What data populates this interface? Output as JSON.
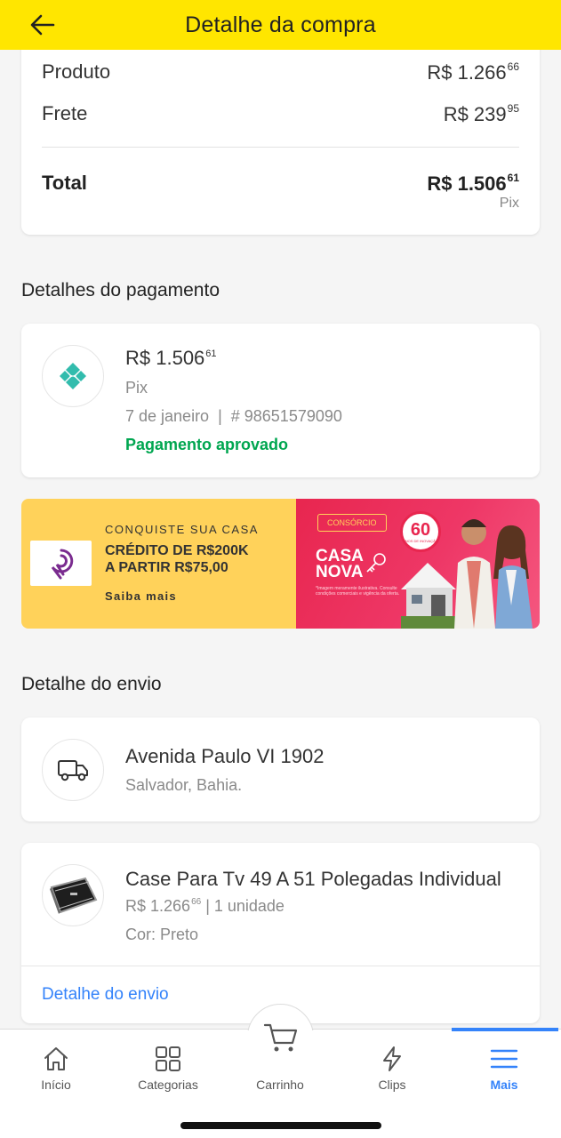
{
  "header": {
    "title": "Detalhe da compra",
    "back_icon": "arrow-left-icon"
  },
  "summary": {
    "product_label": "Produto",
    "product_value": "R$ 1.266",
    "product_cents": "66",
    "shipping_label": "Frete",
    "shipping_value": "R$ 239",
    "shipping_cents": "95",
    "total_label": "Total",
    "total_value": "R$ 1.506",
    "total_cents": "61",
    "method": "Pix"
  },
  "payment": {
    "section_title": "Detalhes do pagamento",
    "amount": "R$ 1.506",
    "amount_cents": "61",
    "type": "Pix",
    "meta": "7 de janeiro  |  # 98651579090",
    "status": "Pagamento aprovado",
    "status_color": "#00a650"
  },
  "banner": {
    "kicker": "CONQUISTE SUA CASA",
    "headline_1": "CRÉDITO DE R$200K",
    "headline_2": "A PARTIR R$75,00",
    "cta": "Saiba mais",
    "tag": "CONSÓRCIO",
    "brand_1": "CASA",
    "brand_2": "NOVA",
    "badge": "60",
    "badge_small": "ANOS DE INOVAÇÃO",
    "fine_print": "*Imagem meramente ilustrativa. Consulte condições comerciais e vigência da oferta."
  },
  "shipping": {
    "section_title": "Detalhe do envio",
    "address_line1": "Avenida Paulo VI 1902",
    "address_line2": "Salvador, Bahia.",
    "product_name": "Case Para Tv 49 A 51 Polegadas Individual",
    "product_price": "R$ 1.266",
    "product_price_cents": "66",
    "product_qty": " | 1 unidade",
    "product_color": "Cor: Preto",
    "link": "Detalhe do envio"
  },
  "nav": {
    "items": [
      {
        "label": "Início",
        "icon": "home-icon"
      },
      {
        "label": "Categorias",
        "icon": "grid-icon"
      },
      {
        "label": "Carrinho",
        "icon": "cart-icon"
      },
      {
        "label": "Clips",
        "icon": "lightning-icon"
      },
      {
        "label": "Mais",
        "icon": "menu-icon"
      }
    ],
    "active": "Mais",
    "accent": "#3483fa"
  },
  "colors": {
    "header_bg": "#ffe600",
    "link": "#3483fa",
    "approved": "#00a650",
    "banner_yellow": "#ffd25a",
    "banner_pink": "#e8264f"
  }
}
